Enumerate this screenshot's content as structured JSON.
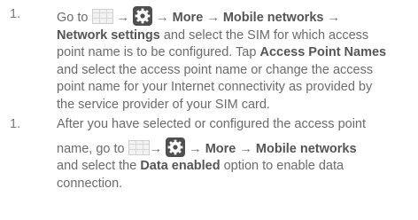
{
  "steps": [
    {
      "number": "1.",
      "lines": [
        {
          "go_to": "Go to",
          "arrow1": "→",
          "arrow2": "→",
          "more": "More",
          "arrow3": "→",
          "mobile_networks": "Mobile networks",
          "arrow4": "→"
        },
        {
          "network_settings": "Network settings",
          "rest": " and select the SIM for which access"
        },
        {
          "pre": "point name is to be configured. Tap ",
          "access_point_names": "Access Point Names"
        },
        {
          "text": "and select the access point name or change the access"
        },
        {
          "text": "point name for your Internet connectivity as provided by"
        },
        {
          "text": "the service provider of your SIM card."
        }
      ]
    },
    {
      "number": "1.",
      "lines": [
        {
          "text": "After you have selected or configured the access point"
        },
        {
          "name_go_to": "name, go to",
          "arrow1": "→",
          "arrow2": "→",
          "more": "More",
          "arrow3": "→",
          "mobile_networks": "Mobile networks"
        },
        {
          "pre": "and select the ",
          "data_enabled": "Data enabled",
          "post": " option to enable data"
        },
        {
          "text": "connection."
        }
      ]
    }
  ],
  "icons": [
    "apps-grid-icon",
    "settings-gear-icon"
  ]
}
